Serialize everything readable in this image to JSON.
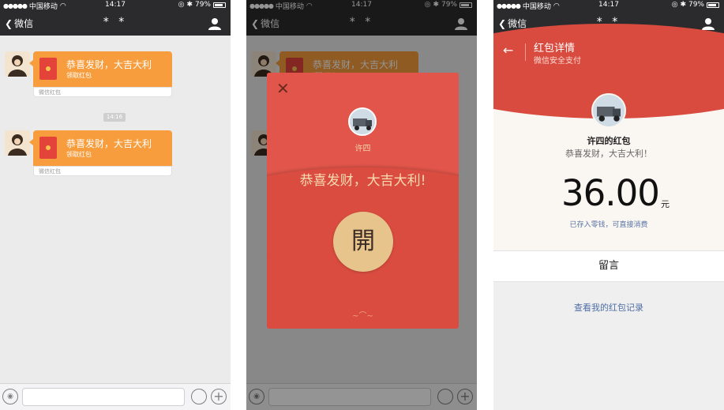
{
  "statusbar": {
    "carrier": "中国移动",
    "time": "14:17",
    "battery": "79%"
  },
  "navbar": {
    "back_label": "微信",
    "title": "* *"
  },
  "chat": {
    "messages": [
      {
        "title": "恭喜发财，大吉大利",
        "subtitle": "领取红包",
        "footer": "微信红包"
      },
      {
        "title": "恭喜发财，大吉大利",
        "subtitle": "领取红包",
        "footer": "微信红包"
      }
    ],
    "timestamp": "14:16"
  },
  "modal": {
    "sender": "许四",
    "wish": "恭喜发财，大吉大利!",
    "open_label": "開"
  },
  "detail": {
    "title": "红包详情",
    "subtitle": "微信安全支付",
    "owner": "许四的红包",
    "wish": "恭喜发财，大吉大利！",
    "amount": "36.00",
    "unit": "元",
    "note": "已存入零钱，可直接消费",
    "comment_label": "留言",
    "record_link": "查看我的红包记录"
  },
  "colors": {
    "nav_bg": "#2b2b2d",
    "bubble_orange": "#f79d3d",
    "packet_red": "#da4c40",
    "open_gold": "#e6c48c"
  }
}
